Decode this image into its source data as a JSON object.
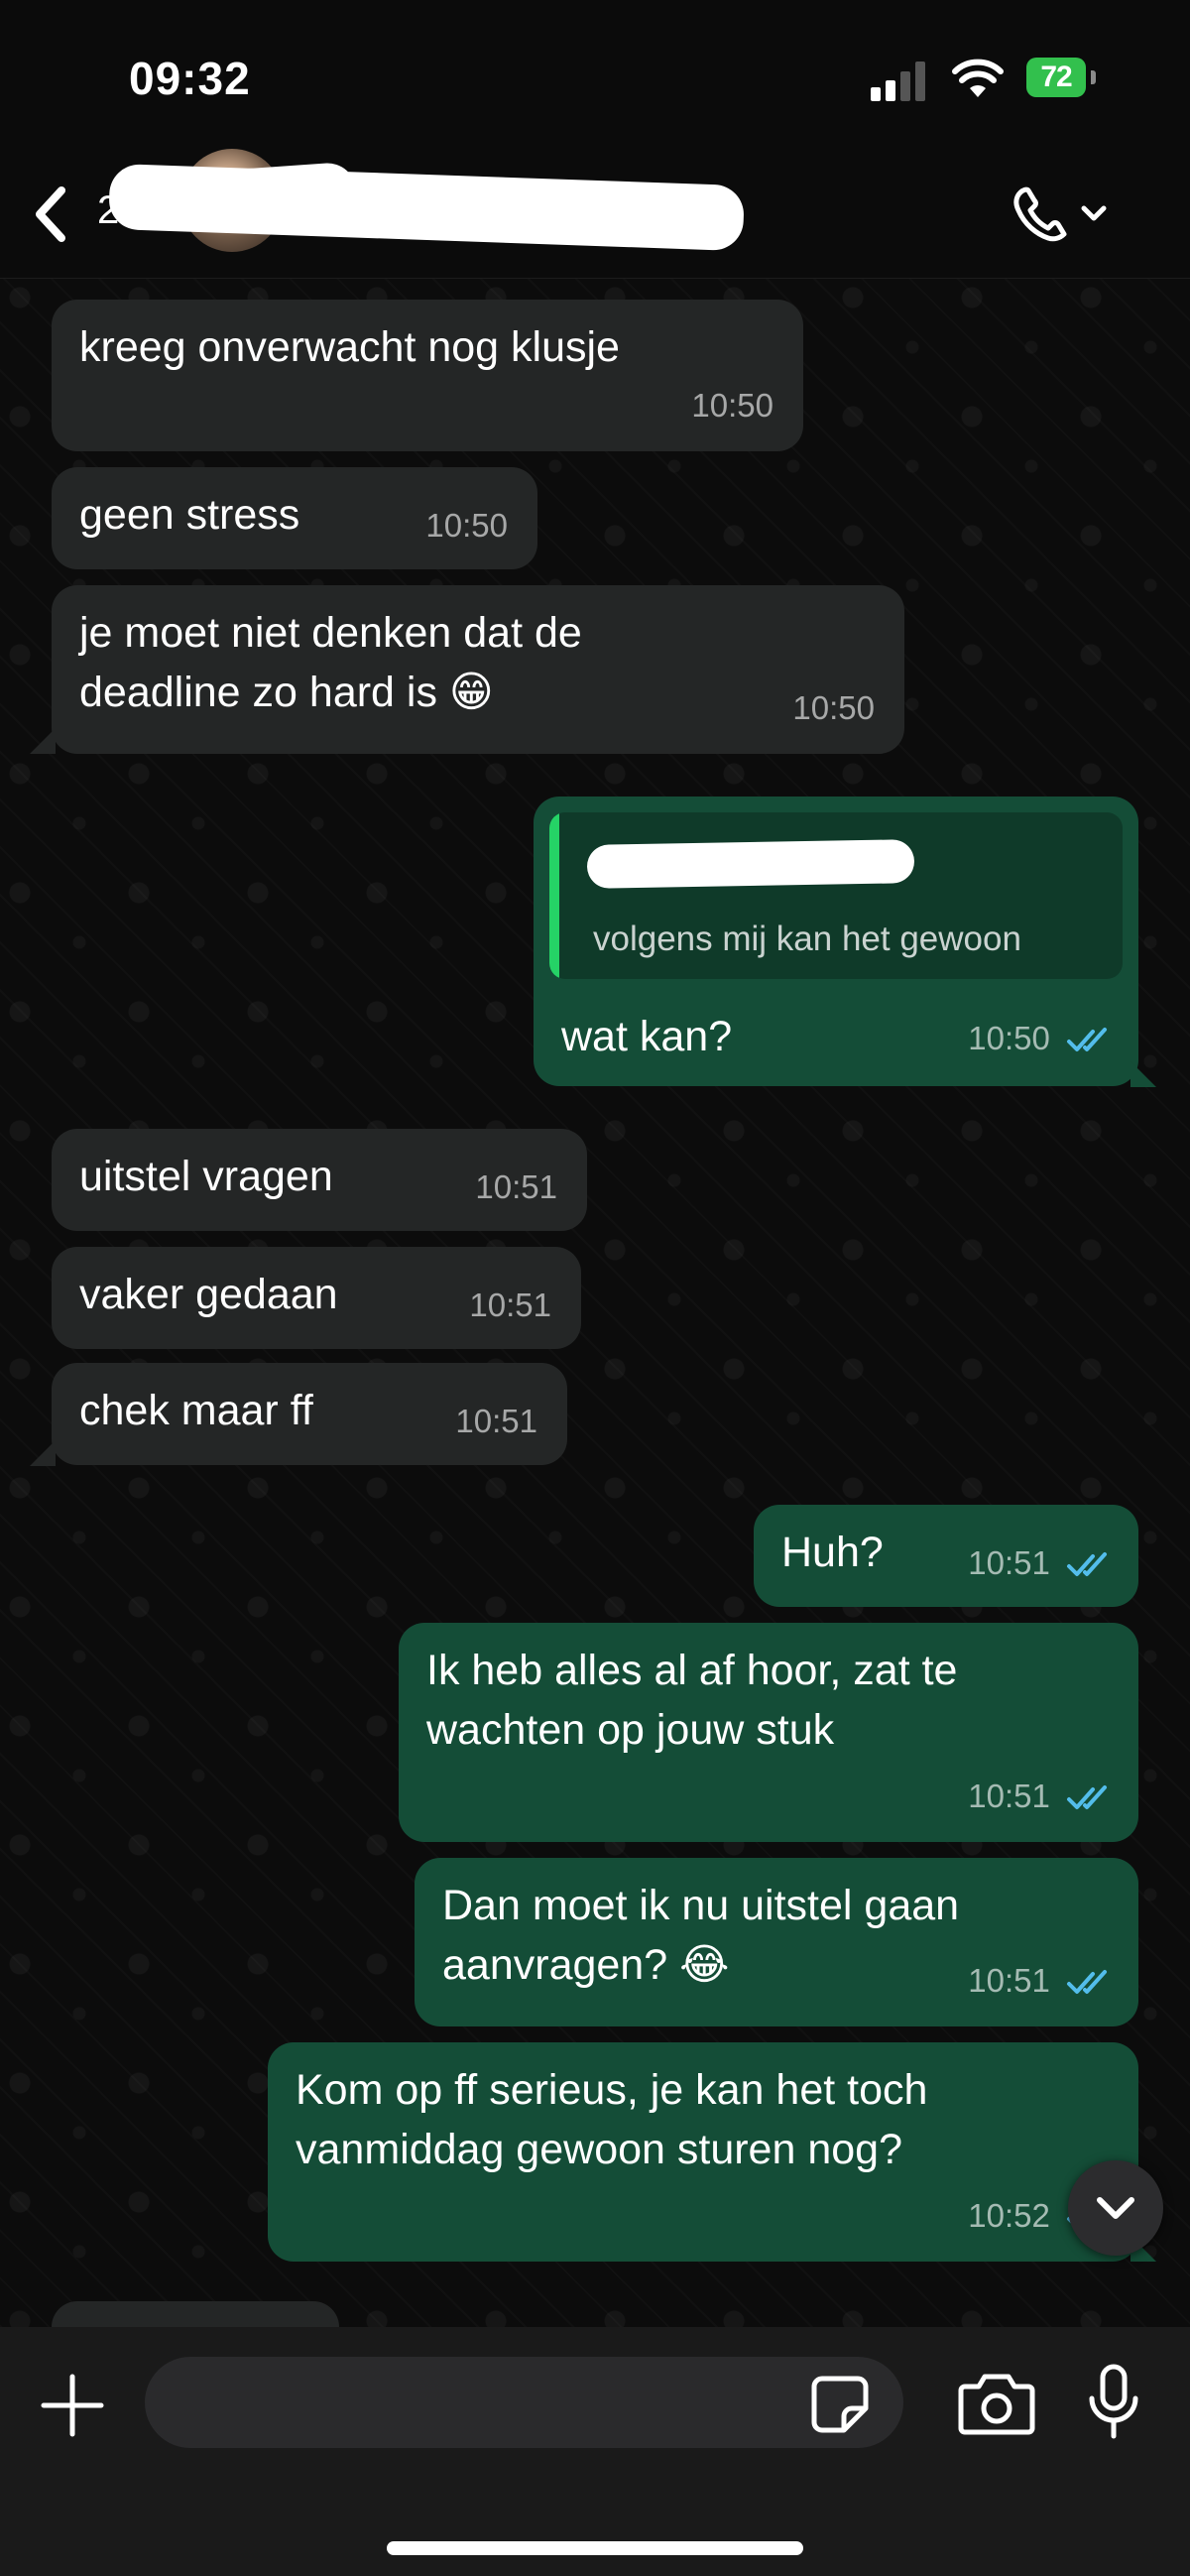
{
  "status_bar": {
    "time": "09:32",
    "battery": "72"
  },
  "header": {
    "contact_count": "2"
  },
  "messages": [
    {
      "text": "kreeg onverwacht nog klusje",
      "time": "10:50"
    },
    {
      "text": "geen stress",
      "time": "10:50"
    },
    {
      "text": "je moet niet denken dat de",
      "text2": "deadline zo hard is 😁",
      "time": "10:50"
    },
    {
      "quote": "volgens mij kan het gewoon",
      "text": "wat kan?",
      "time": "10:50"
    },
    {
      "text": "uitstel vragen",
      "time": "10:51"
    },
    {
      "text": "vaker gedaan",
      "time": "10:51"
    },
    {
      "text": "chek maar ff",
      "time": "10:51"
    },
    {
      "text": "Huh?",
      "time": "10:51"
    },
    {
      "text": "Ik heb alles al af hoor, zat te",
      "text2": "wachten op jouw stuk",
      "time": "10:51"
    },
    {
      "text": "Dan moet ik nu uitstel gaan",
      "text2": "aanvragen? 😂",
      "time": "10:51"
    },
    {
      "text": "Kom op ff serieus, je kan het toch",
      "text2": "vanmiddag gewoon sturen nog?",
      "time": "10:52"
    }
  ],
  "colors": {
    "incoming_bubble": "#242626",
    "outgoing_bubble": "#144d37",
    "read_ticks": "#53bdeb",
    "quote_bar": "#25d366"
  },
  "icons": [
    "back-chevron-icon",
    "phone-icon",
    "chevron-down-icon",
    "plus-icon",
    "sticker-icon",
    "camera-icon",
    "microphone-icon",
    "double-check-icon"
  ]
}
